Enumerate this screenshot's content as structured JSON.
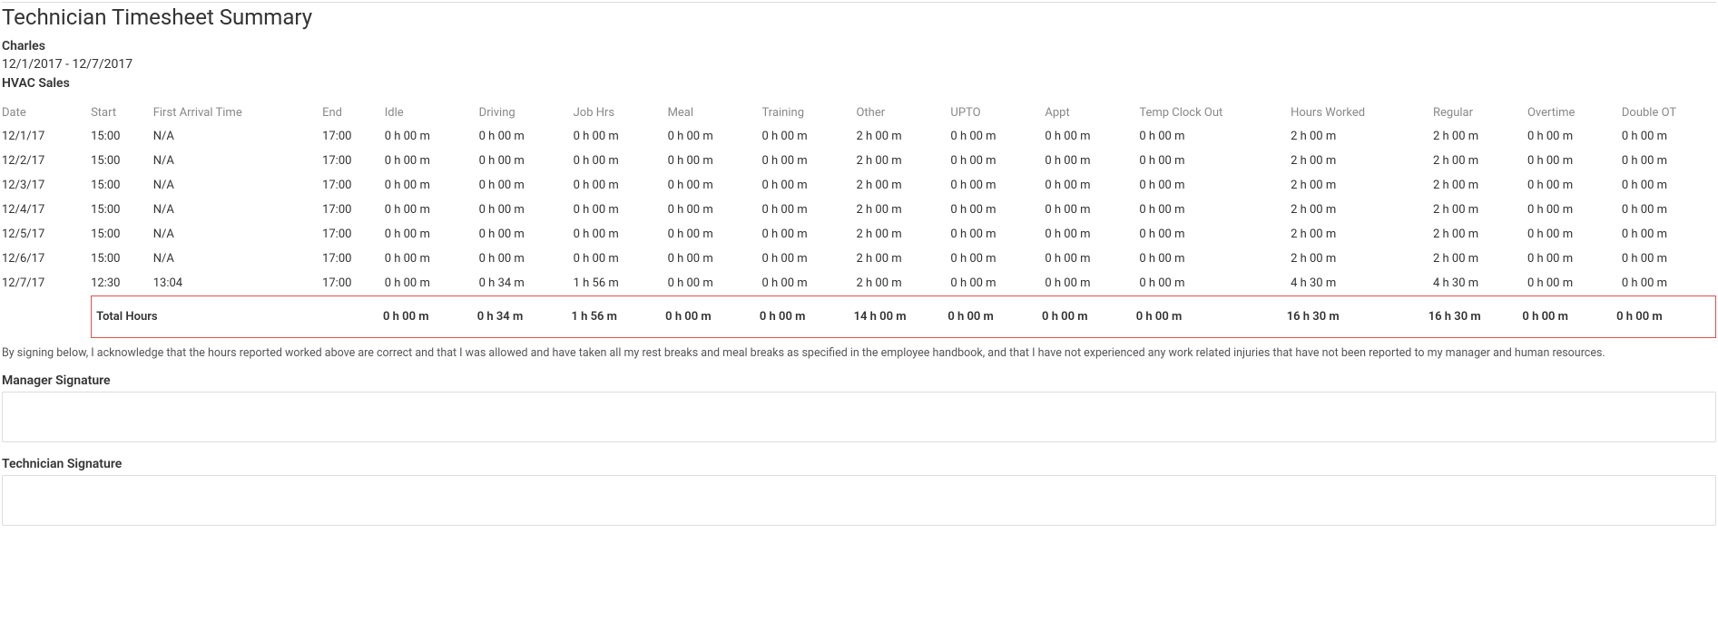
{
  "report": {
    "title": "Technician Timesheet Summary",
    "technician_name": "Charles",
    "date_range": "12/1/2017 - 12/7/2017",
    "business_unit": "HVAC Sales"
  },
  "columns": [
    "Date",
    "Start",
    "First Arrival Time",
    "End",
    "Idle",
    "Driving",
    "Job Hrs",
    "Meal",
    "Training",
    "Other",
    "UPTO",
    "Appt",
    "Temp Clock Out",
    "Hours Worked",
    "Regular",
    "Overtime",
    "Double OT"
  ],
  "rows": [
    {
      "date": "12/1/17",
      "start": "15:00",
      "first_arrival": "N/A",
      "end": "17:00",
      "idle": "0 h 00 m",
      "driving": "0 h 00 m",
      "job_hrs": "0 h 00 m",
      "meal": "0 h 00 m",
      "training": "0 h 00 m",
      "other": "2 h 00 m",
      "upto": "0 h 00 m",
      "appt": "0 h 00 m",
      "temp_clock_out": "0 h 00 m",
      "hours_worked": "2 h 00 m",
      "regular": "2 h 00 m",
      "overtime": "0 h 00 m",
      "double_ot": "0 h 00 m"
    },
    {
      "date": "12/2/17",
      "start": "15:00",
      "first_arrival": "N/A",
      "end": "17:00",
      "idle": "0 h 00 m",
      "driving": "0 h 00 m",
      "job_hrs": "0 h 00 m",
      "meal": "0 h 00 m",
      "training": "0 h 00 m",
      "other": "2 h 00 m",
      "upto": "0 h 00 m",
      "appt": "0 h 00 m",
      "temp_clock_out": "0 h 00 m",
      "hours_worked": "2 h 00 m",
      "regular": "2 h 00 m",
      "overtime": "0 h 00 m",
      "double_ot": "0 h 00 m"
    },
    {
      "date": "12/3/17",
      "start": "15:00",
      "first_arrival": "N/A",
      "end": "17:00",
      "idle": "0 h 00 m",
      "driving": "0 h 00 m",
      "job_hrs": "0 h 00 m",
      "meal": "0 h 00 m",
      "training": "0 h 00 m",
      "other": "2 h 00 m",
      "upto": "0 h 00 m",
      "appt": "0 h 00 m",
      "temp_clock_out": "0 h 00 m",
      "hours_worked": "2 h 00 m",
      "regular": "2 h 00 m",
      "overtime": "0 h 00 m",
      "double_ot": "0 h 00 m"
    },
    {
      "date": "12/4/17",
      "start": "15:00",
      "first_arrival": "N/A",
      "end": "17:00",
      "idle": "0 h 00 m",
      "driving": "0 h 00 m",
      "job_hrs": "0 h 00 m",
      "meal": "0 h 00 m",
      "training": "0 h 00 m",
      "other": "2 h 00 m",
      "upto": "0 h 00 m",
      "appt": "0 h 00 m",
      "temp_clock_out": "0 h 00 m",
      "hours_worked": "2 h 00 m",
      "regular": "2 h 00 m",
      "overtime": "0 h 00 m",
      "double_ot": "0 h 00 m"
    },
    {
      "date": "12/5/17",
      "start": "15:00",
      "first_arrival": "N/A",
      "end": "17:00",
      "idle": "0 h 00 m",
      "driving": "0 h 00 m",
      "job_hrs": "0 h 00 m",
      "meal": "0 h 00 m",
      "training": "0 h 00 m",
      "other": "2 h 00 m",
      "upto": "0 h 00 m",
      "appt": "0 h 00 m",
      "temp_clock_out": "0 h 00 m",
      "hours_worked": "2 h 00 m",
      "regular": "2 h 00 m",
      "overtime": "0 h 00 m",
      "double_ot": "0 h 00 m"
    },
    {
      "date": "12/6/17",
      "start": "15:00",
      "first_arrival": "N/A",
      "end": "17:00",
      "idle": "0 h 00 m",
      "driving": "0 h 00 m",
      "job_hrs": "0 h 00 m",
      "meal": "0 h 00 m",
      "training": "0 h 00 m",
      "other": "2 h 00 m",
      "upto": "0 h 00 m",
      "appt": "0 h 00 m",
      "temp_clock_out": "0 h 00 m",
      "hours_worked": "2 h 00 m",
      "regular": "2 h 00 m",
      "overtime": "0 h 00 m",
      "double_ot": "0 h 00 m"
    },
    {
      "date": "12/7/17",
      "start": "12:30",
      "first_arrival": "13:04",
      "end": "17:00",
      "idle": "0 h 00 m",
      "driving": "0 h 34 m",
      "job_hrs": "1 h 56 m",
      "meal": "0 h 00 m",
      "training": "0 h 00 m",
      "other": "2 h 00 m",
      "upto": "0 h 00 m",
      "appt": "0 h 00 m",
      "temp_clock_out": "0 h 00 m",
      "hours_worked": "4 h 30 m",
      "regular": "4 h 30 m",
      "overtime": "0 h 00 m",
      "double_ot": "0 h 00 m"
    }
  ],
  "totals": {
    "label": "Total Hours",
    "idle": "0 h 00 m",
    "driving": "0 h 34 m",
    "job_hrs": "1 h 56 m",
    "meal": "0 h 00 m",
    "training": "0 h 00 m",
    "other": "14 h 00 m",
    "upto": "0 h 00 m",
    "appt": "0 h 00 m",
    "temp_clock_out": "0 h 00 m",
    "hours_worked": "16 h 30 m",
    "regular": "16 h 30 m",
    "overtime": "0 h 00 m",
    "double_ot": "0 h 00 m"
  },
  "acknowledgement_text": "By signing below, I acknowledge that the hours reported worked above are correct and that I was allowed and have taken all my rest breaks and meal breaks as specified in the employee handbook, and that I have not experienced any work related injuries that have not been reported to my manager and human resources.",
  "signatures": {
    "manager_label": "Manager Signature",
    "technician_label": "Technician Signature"
  }
}
